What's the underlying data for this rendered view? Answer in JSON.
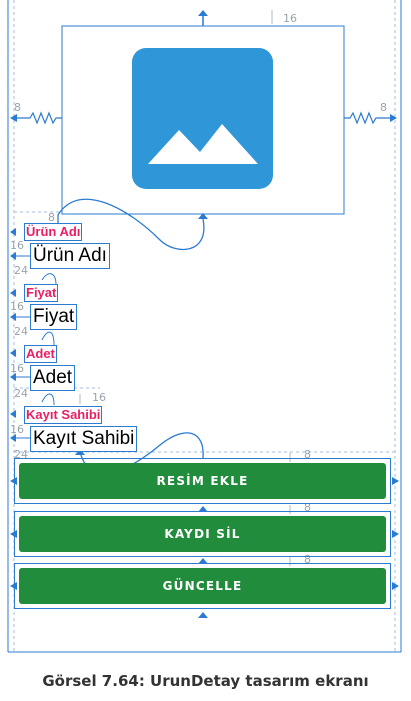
{
  "constraints": {
    "top": "16",
    "left_margin": "8",
    "right_margin": "8",
    "label_gap": "16",
    "field_gap": "24",
    "small_gap": "8"
  },
  "form": {
    "urun_adi_label": "Ürün Adı",
    "urun_adi_field": "Ürün Adı",
    "fiyat_label": "Fiyat",
    "fiyat_field": "Fiyat",
    "adet_label": "Adet",
    "adet_field": "Adet",
    "kayit_sahibi_label": "Kayıt Sahibi",
    "kayit_sahibi_field": "Kayıt Sahibi"
  },
  "buttons": {
    "resim_ekle": "RESİM EKLE",
    "kaydi_sil": "KAYDI SİL",
    "guncelle": "GÜNCELLE"
  },
  "caption": "Görsel 7.64: UrunDetay tasarım ekranı",
  "colors": {
    "accent": "#2b7bd1",
    "label": "#e91e63",
    "button": "#218c3c",
    "image_bg": "#2f96d8"
  },
  "icons": {
    "image_placeholder": "image-icon"
  }
}
